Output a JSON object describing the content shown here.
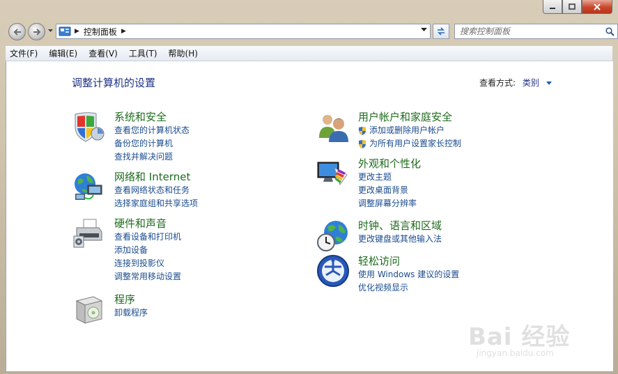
{
  "window": {
    "minimize_label": "minimize",
    "maximize_label": "maximize",
    "close_label": "close"
  },
  "address": {
    "path": "控制面板",
    "search_placeholder": "搜索控制面板"
  },
  "menu": [
    "文件(F)",
    "编辑(E)",
    "查看(V)",
    "工具(T)",
    "帮助(H)"
  ],
  "page": {
    "title": "调整计算机的设置",
    "view_label": "查看方式:",
    "view_value": "类别"
  },
  "categories": [
    {
      "icon": "shield-security-icon",
      "title": "系统和安全",
      "links": [
        "查看您的计算机状态",
        "备份您的计算机",
        "查找并解决问题"
      ]
    },
    {
      "icon": "network-globe-icon",
      "title": "网络和 Internet",
      "links": [
        "查看网络状态和任务",
        "选择家庭组和共享选项"
      ]
    },
    {
      "icon": "printer-hardware-icon",
      "title": "硬件和声音",
      "links": [
        "查看设备和打印机",
        "添加设备",
        "连接到投影仪",
        "调整常用移动设置"
      ]
    },
    {
      "icon": "programs-box-icon",
      "title": "程序",
      "links": [
        "卸载程序"
      ]
    },
    {
      "icon": "users-icon",
      "title": "用户帐户和家庭安全",
      "links": [
        "添加或删除用户帐户",
        "为所有用户设置家长控制"
      ]
    },
    {
      "icon": "monitor-palette-icon",
      "title": "外观和个性化",
      "links": [
        "更改主题",
        "更改桌面背景",
        "调整屏幕分辨率"
      ]
    },
    {
      "icon": "clock-globe-icon",
      "title": "时钟、语言和区域",
      "links": [
        "更改键盘或其他输入法"
      ]
    },
    {
      "icon": "ease-of-access-icon",
      "title": "轻松访问",
      "links": [
        "使用 Windows 建议的设置",
        "优化视频显示"
      ]
    }
  ],
  "watermark": {
    "main": "Bai 经验",
    "sub": "jingyan.baidu.com"
  },
  "colors": {
    "category_title": "#1d6b1d",
    "link": "#1a4b8f",
    "heading": "#1e3287"
  }
}
